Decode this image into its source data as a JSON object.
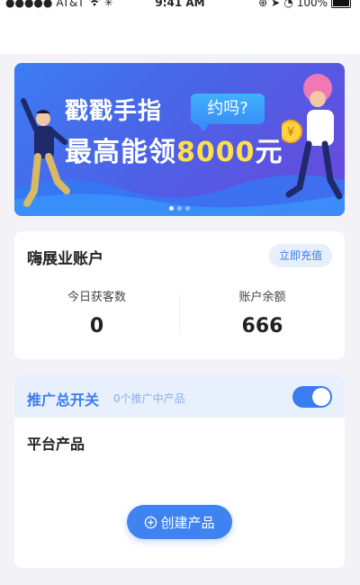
{
  "status_bar": {
    "carrier": "AT&T",
    "time": "9:41 AM",
    "battery": "100%"
  },
  "banner": {
    "line1": "戳戳手指",
    "line2_prefix": "最高能领",
    "line2_number": "8000",
    "line2_suffix": "元",
    "bubble": "约吗?",
    "coin_symbol": "¥",
    "page_count": 3,
    "active_page": 1,
    "colors": {
      "gradient_start": "#3c7cf3",
      "gradient_end": "#6b46dc",
      "highlight": "#ffe04a"
    }
  },
  "account": {
    "title": "嗨展业账户",
    "recharge_label": "立即充值",
    "stats": [
      {
        "label": "今日获客数",
        "value": "0"
      },
      {
        "label": "账户余额",
        "value": "666"
      }
    ]
  },
  "promotion": {
    "title": "推广总开关",
    "subtitle": "0个推广中产品",
    "toggle_on": true,
    "platform_title": "平台产品",
    "create_label": "创建产品",
    "accent": "#3a7df0"
  }
}
